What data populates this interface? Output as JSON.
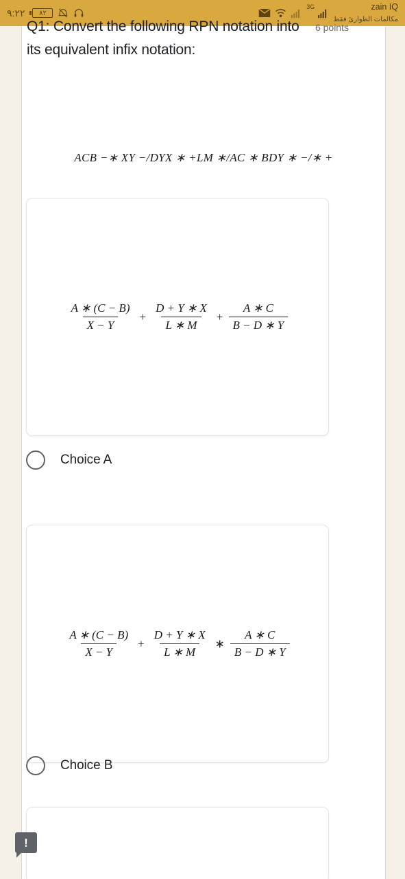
{
  "statusbar": {
    "time": "٩:٢٢",
    "battery_level": "٨٢",
    "icons": {
      "alarm_off": "alarm-off-icon",
      "headset": "headset-icon",
      "envelope": "envelope-icon",
      "wifi": "wifi-icon",
      "signal_empty": "signal-no-service-icon",
      "signal_full": "signal-bars-icon"
    },
    "network_type": "3G",
    "carrier_name": "zain IQ",
    "carrier_note": "مكالمات الطوارئ فقط"
  },
  "question": {
    "title": "Q1: Convert the following RPN notation into its equivalent infix notation:",
    "points": "6 points",
    "rpn_expression": "ACB −∗ XY −/DYX ∗ +LM ∗/AC ∗ BDY ∗ −/∗ +"
  },
  "options": [
    {
      "id": "A",
      "label": "Choice A",
      "selected": false,
      "formula": {
        "terms": [
          {
            "num": "A ∗ (C − B)",
            "den": "X − Y"
          },
          {
            "num": "D + Y ∗ X",
            "den": "L ∗ M"
          },
          {
            "num": "A ∗ C",
            "den": "B − D ∗ Y"
          }
        ],
        "operators": [
          "+",
          "+"
        ]
      }
    },
    {
      "id": "B",
      "label": "Choice B",
      "selected": false,
      "formula": {
        "terms": [
          {
            "num": "A ∗ (C − B)",
            "den": "X − Y"
          },
          {
            "num": "D + Y ∗ X",
            "den": "L ∗ M"
          },
          {
            "num": "A ∗ C",
            "den": "B − D ∗ Y"
          }
        ],
        "operators": [
          "+",
          "∗"
        ]
      }
    },
    {
      "id": "C",
      "label": "",
      "selected": false,
      "formula": {
        "terms": [],
        "operators": []
      }
    }
  ],
  "error_badge": {
    "symbol": "!",
    "name": "required-error-badge"
  },
  "colors": {
    "statusbar_bg": "#d9a83f",
    "page_bg": "#f6f1e6",
    "card_border": "#e4e4e4",
    "text_primary": "#202124",
    "text_secondary": "#6d6d6d"
  }
}
